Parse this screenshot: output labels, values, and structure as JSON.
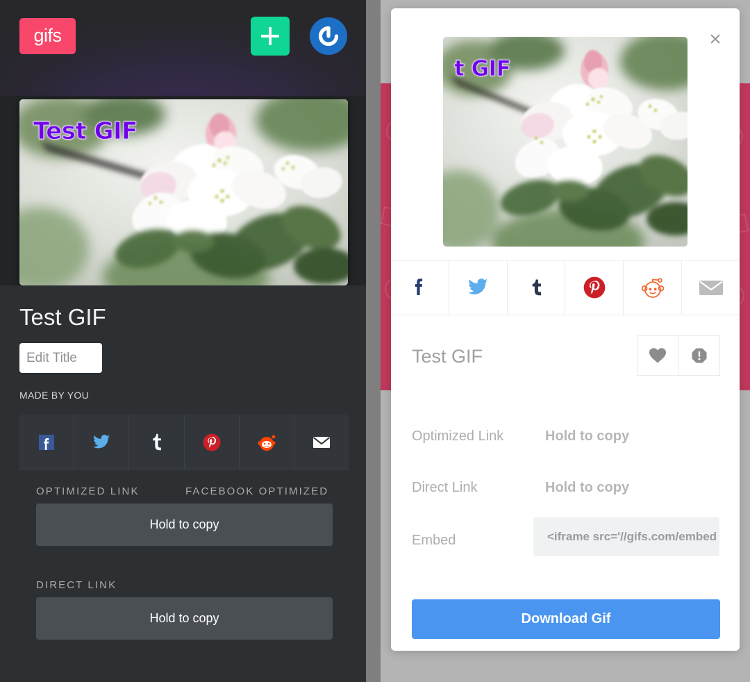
{
  "app": {
    "brand": "gifs",
    "brand_color": "#f8476a",
    "add_color": "#0fd694",
    "avatar_color": "#1c6fc4"
  },
  "header": {
    "logo_label": "gifs",
    "add_button_label": "+",
    "avatar_label": ""
  },
  "gif": {
    "overlay_title": "Test GIF",
    "title": "Test GIF",
    "edit_title_value": "Edit Title",
    "made_by_label": "MADE BY YOU"
  },
  "share": {
    "items": [
      {
        "name": "facebook",
        "glyph": "f"
      },
      {
        "name": "twitter",
        "glyph": "t"
      },
      {
        "name": "tumblr",
        "glyph": "t"
      },
      {
        "name": "pinterest",
        "glyph": "P"
      },
      {
        "name": "reddit",
        "glyph": "r"
      },
      {
        "name": "email",
        "glyph": "M"
      }
    ]
  },
  "links": {
    "optimized_label": "OPTIMIZED LINK",
    "facebook_optimized_label": "FACEBOOK OPTIMIZED",
    "optimized_action": "Hold to copy",
    "direct_label": "DIRECT LINK",
    "direct_action": "Hold to copy"
  },
  "modal": {
    "close_label": "×",
    "overlay_title": "t GIF",
    "title": "Test GIF",
    "like_label": "",
    "report_label": "",
    "rows": [
      {
        "label": "Optimized Link",
        "value": "Hold to copy"
      },
      {
        "label": "Direct Link",
        "value": "Hold to copy"
      }
    ],
    "embed_label": "Embed",
    "embed_value": "<iframe src='//gifs.com/embed",
    "download_label": "Download Gif",
    "download_color": "#4a95ef"
  }
}
